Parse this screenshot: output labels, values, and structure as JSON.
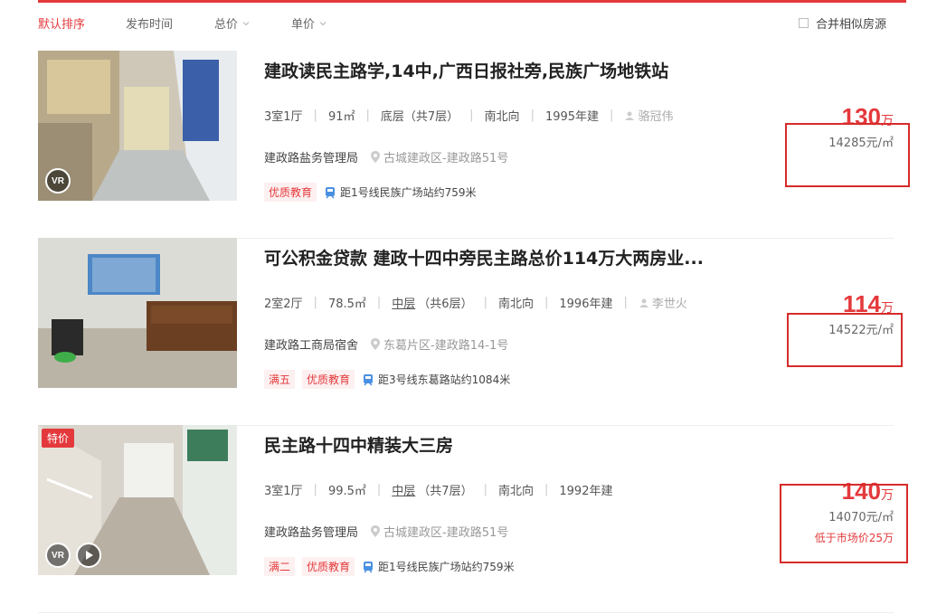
{
  "sortbar": {
    "items": [
      {
        "label": "默认排序",
        "active": true
      },
      {
        "label": "发布时间",
        "active": false
      },
      {
        "label": "总价",
        "active": false,
        "icon": "chevron-down-icon"
      },
      {
        "label": "单价",
        "active": false,
        "icon": "chevron-down-icon"
      }
    ],
    "merge_label": "合并相似房源"
  },
  "listings": [
    {
      "title": "建政读民主路学,14中,广西日报社旁,民族广场地铁站",
      "layout": "3室1厅",
      "area": "91㎡",
      "floor": "底层（共7层）",
      "orientation": "南北向",
      "year": "1995年建",
      "agent": "骆冠伟",
      "community": "建政路盐务管理局",
      "location": "古城建政区-建政路51号",
      "tags": [
        "优质教育"
      ],
      "subway": "距1号线民族广场站约759米",
      "price_total": "130",
      "price_unit_label": "万",
      "price_per_sqm": "14285元/㎡",
      "badges": [
        "VR"
      ]
    },
    {
      "title": "可公积金贷款 建政十四中旁民主路总价114万大两房业...",
      "layout": "2室2厅",
      "area": "78.5㎡",
      "floor_level": "中层",
      "floor_total": "（共6层）",
      "orientation": "南北向",
      "year": "1996年建",
      "agent": "李世火",
      "community": "建政路工商局宿舍",
      "location": "东葛片区-建政路14-1号",
      "tags": [
        "满五",
        "优质教育"
      ],
      "subway": "距3号线东葛路站约1084米",
      "price_total": "114",
      "price_unit_label": "万",
      "price_per_sqm": "14522元/㎡"
    },
    {
      "title": "民主路十四中精装大三房",
      "layout": "3室1厅",
      "area": "99.5㎡",
      "floor_level": "中层",
      "floor_total": "（共7层）",
      "orientation": "南北向",
      "year": "1992年建",
      "community": "建政路盐务管理局",
      "location": "古城建政区-建政路51号",
      "tags": [
        "满二",
        "优质教育"
      ],
      "subway": "距1号线民族广场站约759米",
      "price_total": "140",
      "price_unit_label": "万",
      "price_per_sqm": "14070元/㎡",
      "price_note": "低于市场价25万",
      "special_badge": "特价",
      "badges": [
        "VR"
      ]
    }
  ],
  "colors": {
    "accent": "#e4393c",
    "annotation_box": "#d62b2b"
  }
}
